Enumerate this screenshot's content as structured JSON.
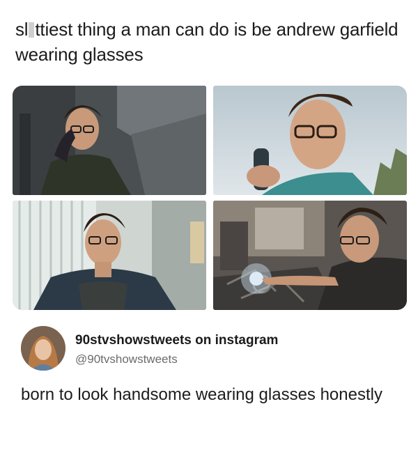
{
  "post": {
    "text_part1": "sl",
    "text_part2": "ttiest thing a man can do is be andrew garfield wearing glasses"
  },
  "images": [
    {
      "name": "photo-top-left"
    },
    {
      "name": "photo-top-right"
    },
    {
      "name": "photo-bottom-left"
    },
    {
      "name": "photo-bottom-right"
    }
  ],
  "quoted_post": {
    "display_name": "90stvshowstweets on instagram",
    "handle": "@90tvshowstweets",
    "text": "born to look handsome wearing glasses honestly"
  },
  "colors": {
    "background": "#ffffff",
    "text": "#1c1c1c",
    "handle": "#6b6b6b",
    "redaction": "#cfcfcf"
  }
}
